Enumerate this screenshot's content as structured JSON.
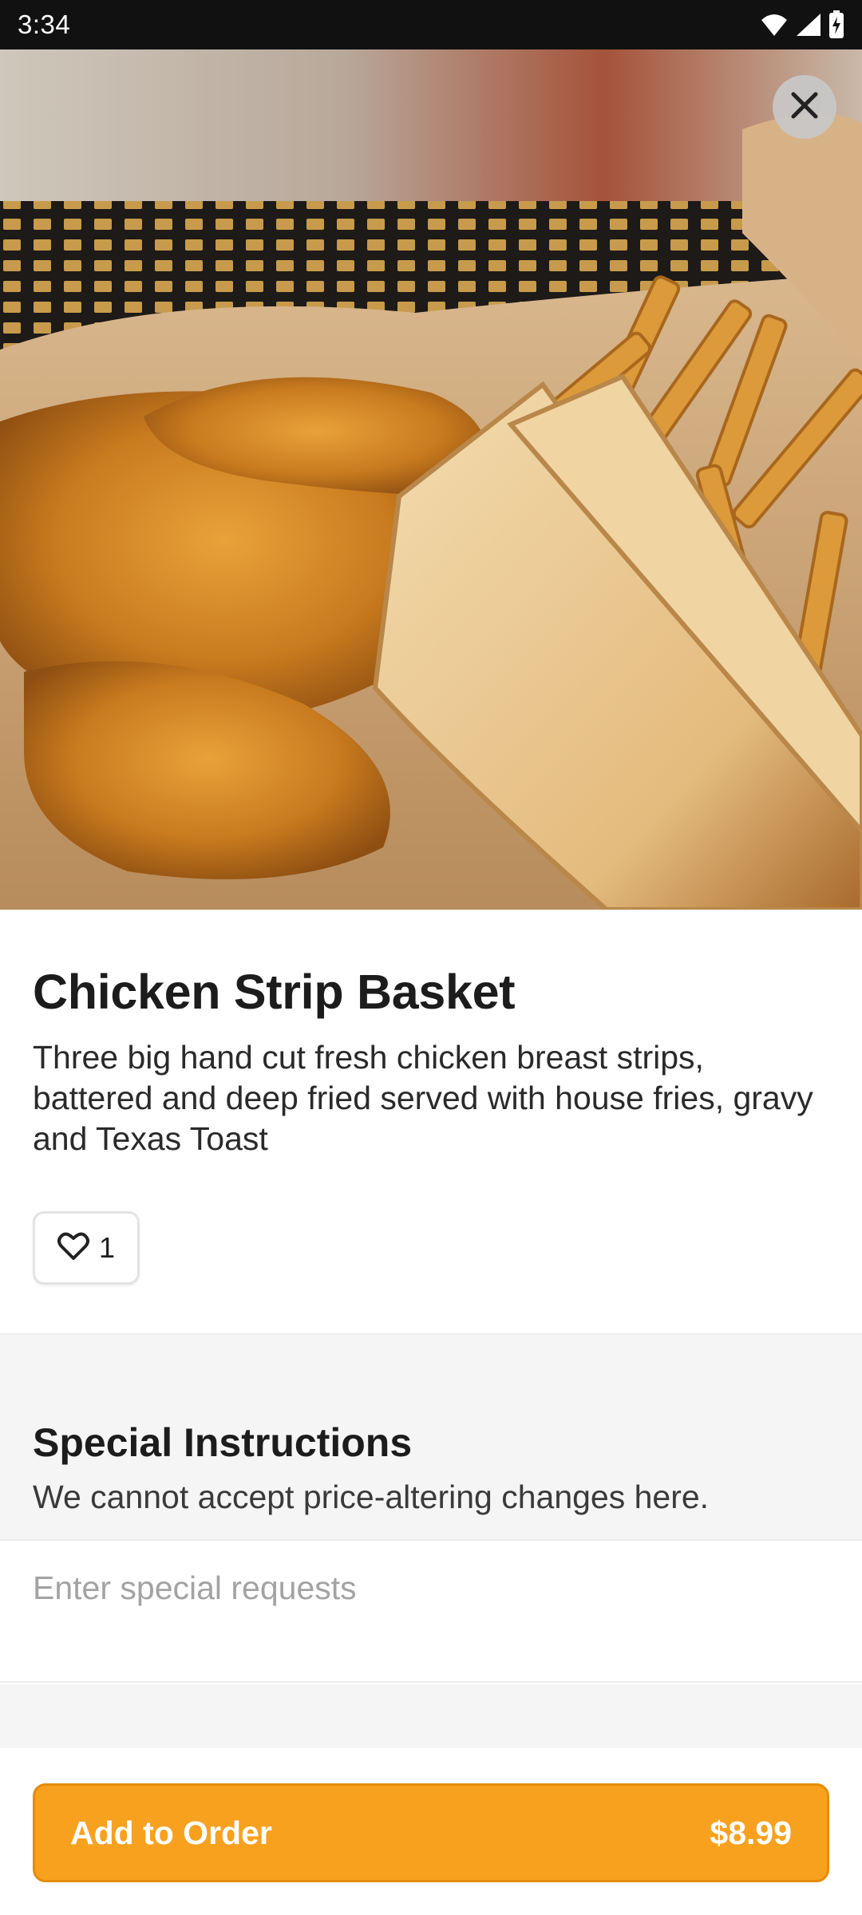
{
  "status_bar": {
    "time": "3:34",
    "icons": [
      "wifi-icon",
      "signal-icon",
      "battery-charging-icon"
    ]
  },
  "hero": {
    "image_subject": "fried chicken strips with fries and texas toast in paper-lined basket",
    "close_icon": "close-icon"
  },
  "item": {
    "title": "Chicken Strip Basket",
    "description": "Three big hand cut fresh chicken breast strips, battered and deep fried served with house fries, gravy and Texas Toast",
    "like_icon": "heart-outline-icon",
    "like_count": "1"
  },
  "special_instructions": {
    "title": "Special Instructions",
    "subtitle": "We cannot accept price-altering changes here.",
    "placeholder": "Enter special requests",
    "value": ""
  },
  "footer": {
    "button_label": "Add to Order",
    "price": "$8.99",
    "accent_color": "#f8a11f"
  }
}
